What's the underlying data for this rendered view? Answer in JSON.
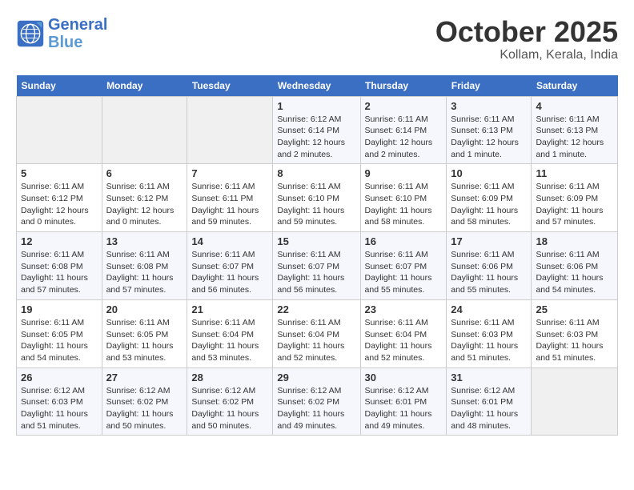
{
  "header": {
    "logo_line1": "General",
    "logo_line2": "Blue",
    "month": "October 2025",
    "location": "Kollam, Kerala, India"
  },
  "weekdays": [
    "Sunday",
    "Monday",
    "Tuesday",
    "Wednesday",
    "Thursday",
    "Friday",
    "Saturday"
  ],
  "weeks": [
    [
      {
        "day": "",
        "info": ""
      },
      {
        "day": "",
        "info": ""
      },
      {
        "day": "",
        "info": ""
      },
      {
        "day": "1",
        "info": "Sunrise: 6:12 AM\nSunset: 6:14 PM\nDaylight: 12 hours and 2 minutes."
      },
      {
        "day": "2",
        "info": "Sunrise: 6:11 AM\nSunset: 6:14 PM\nDaylight: 12 hours and 2 minutes."
      },
      {
        "day": "3",
        "info": "Sunrise: 6:11 AM\nSunset: 6:13 PM\nDaylight: 12 hours and 1 minute."
      },
      {
        "day": "4",
        "info": "Sunrise: 6:11 AM\nSunset: 6:13 PM\nDaylight: 12 hours and 1 minute."
      }
    ],
    [
      {
        "day": "5",
        "info": "Sunrise: 6:11 AM\nSunset: 6:12 PM\nDaylight: 12 hours and 0 minutes."
      },
      {
        "day": "6",
        "info": "Sunrise: 6:11 AM\nSunset: 6:12 PM\nDaylight: 12 hours and 0 minutes."
      },
      {
        "day": "7",
        "info": "Sunrise: 6:11 AM\nSunset: 6:11 PM\nDaylight: 11 hours and 59 minutes."
      },
      {
        "day": "8",
        "info": "Sunrise: 6:11 AM\nSunset: 6:10 PM\nDaylight: 11 hours and 59 minutes."
      },
      {
        "day": "9",
        "info": "Sunrise: 6:11 AM\nSunset: 6:10 PM\nDaylight: 11 hours and 58 minutes."
      },
      {
        "day": "10",
        "info": "Sunrise: 6:11 AM\nSunset: 6:09 PM\nDaylight: 11 hours and 58 minutes."
      },
      {
        "day": "11",
        "info": "Sunrise: 6:11 AM\nSunset: 6:09 PM\nDaylight: 11 hours and 57 minutes."
      }
    ],
    [
      {
        "day": "12",
        "info": "Sunrise: 6:11 AM\nSunset: 6:08 PM\nDaylight: 11 hours and 57 minutes."
      },
      {
        "day": "13",
        "info": "Sunrise: 6:11 AM\nSunset: 6:08 PM\nDaylight: 11 hours and 57 minutes."
      },
      {
        "day": "14",
        "info": "Sunrise: 6:11 AM\nSunset: 6:07 PM\nDaylight: 11 hours and 56 minutes."
      },
      {
        "day": "15",
        "info": "Sunrise: 6:11 AM\nSunset: 6:07 PM\nDaylight: 11 hours and 56 minutes."
      },
      {
        "day": "16",
        "info": "Sunrise: 6:11 AM\nSunset: 6:07 PM\nDaylight: 11 hours and 55 minutes."
      },
      {
        "day": "17",
        "info": "Sunrise: 6:11 AM\nSunset: 6:06 PM\nDaylight: 11 hours and 55 minutes."
      },
      {
        "day": "18",
        "info": "Sunrise: 6:11 AM\nSunset: 6:06 PM\nDaylight: 11 hours and 54 minutes."
      }
    ],
    [
      {
        "day": "19",
        "info": "Sunrise: 6:11 AM\nSunset: 6:05 PM\nDaylight: 11 hours and 54 minutes."
      },
      {
        "day": "20",
        "info": "Sunrise: 6:11 AM\nSunset: 6:05 PM\nDaylight: 11 hours and 53 minutes."
      },
      {
        "day": "21",
        "info": "Sunrise: 6:11 AM\nSunset: 6:04 PM\nDaylight: 11 hours and 53 minutes."
      },
      {
        "day": "22",
        "info": "Sunrise: 6:11 AM\nSunset: 6:04 PM\nDaylight: 11 hours and 52 minutes."
      },
      {
        "day": "23",
        "info": "Sunrise: 6:11 AM\nSunset: 6:04 PM\nDaylight: 11 hours and 52 minutes."
      },
      {
        "day": "24",
        "info": "Sunrise: 6:11 AM\nSunset: 6:03 PM\nDaylight: 11 hours and 51 minutes."
      },
      {
        "day": "25",
        "info": "Sunrise: 6:11 AM\nSunset: 6:03 PM\nDaylight: 11 hours and 51 minutes."
      }
    ],
    [
      {
        "day": "26",
        "info": "Sunrise: 6:12 AM\nSunset: 6:03 PM\nDaylight: 11 hours and 51 minutes."
      },
      {
        "day": "27",
        "info": "Sunrise: 6:12 AM\nSunset: 6:02 PM\nDaylight: 11 hours and 50 minutes."
      },
      {
        "day": "28",
        "info": "Sunrise: 6:12 AM\nSunset: 6:02 PM\nDaylight: 11 hours and 50 minutes."
      },
      {
        "day": "29",
        "info": "Sunrise: 6:12 AM\nSunset: 6:02 PM\nDaylight: 11 hours and 49 minutes."
      },
      {
        "day": "30",
        "info": "Sunrise: 6:12 AM\nSunset: 6:01 PM\nDaylight: 11 hours and 49 minutes."
      },
      {
        "day": "31",
        "info": "Sunrise: 6:12 AM\nSunset: 6:01 PM\nDaylight: 11 hours and 48 minutes."
      },
      {
        "day": "",
        "info": ""
      }
    ]
  ]
}
